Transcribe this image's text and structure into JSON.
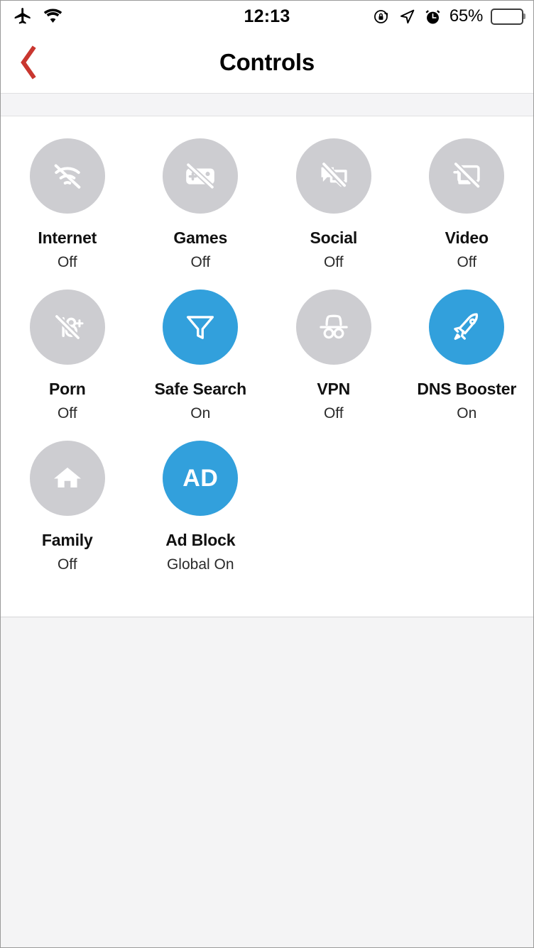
{
  "status_bar": {
    "airplane_icon": "airplane-mode-icon",
    "wifi_icon": "wifi-icon",
    "time": "12:13",
    "rotation_lock_icon": "rotation-lock-icon",
    "location_icon": "location-arrow-icon",
    "alarm_icon": "alarm-clock-icon",
    "battery_percent": "65%",
    "battery_level": 65
  },
  "nav": {
    "back_icon": "back-chevron-icon",
    "title": "Controls",
    "back_color": "#c9362f"
  },
  "theme": {
    "accent_on": "#32a0dc",
    "tile_off": "#cdcdd1",
    "page_bg": "#f4f4f5",
    "card_bg": "#ffffff"
  },
  "controls": [
    {
      "id": "internet",
      "label": "Internet",
      "state": "Off",
      "enabled": false,
      "icon": "wifi-slash-icon"
    },
    {
      "id": "games",
      "label": "Games",
      "state": "Off",
      "enabled": false,
      "icon": "gamepad-slash-icon"
    },
    {
      "id": "social",
      "label": "Social",
      "state": "Off",
      "enabled": false,
      "icon": "chat-bubbles-slash-icon"
    },
    {
      "id": "video",
      "label": "Video",
      "state": "Off",
      "enabled": false,
      "icon": "monitor-slash-icon"
    },
    {
      "id": "porn",
      "label": "Porn",
      "state": "Off",
      "enabled": false,
      "icon": "eighteen-plus-slash-icon"
    },
    {
      "id": "safe-search",
      "label": "Safe Search",
      "state": "On",
      "enabled": true,
      "icon": "funnel-icon"
    },
    {
      "id": "vpn",
      "label": "VPN",
      "state": "Off",
      "enabled": false,
      "icon": "incognito-icon"
    },
    {
      "id": "dns-booster",
      "label": "DNS Booster",
      "state": "On",
      "enabled": true,
      "icon": "rocket-icon"
    },
    {
      "id": "family",
      "label": "Family",
      "state": "Off",
      "enabled": false,
      "icon": "home-icon"
    },
    {
      "id": "ad-block",
      "label": "Ad Block",
      "state": "Global On",
      "enabled": true,
      "icon": "ad-text-icon",
      "icon_text": "AD"
    }
  ]
}
